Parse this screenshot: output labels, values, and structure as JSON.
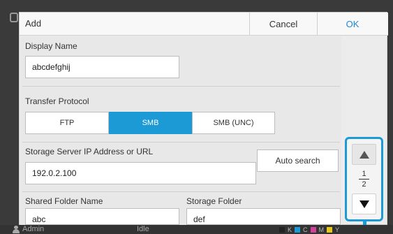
{
  "dialog": {
    "title": "Add",
    "cancel_label": "Cancel",
    "ok_label": "OK"
  },
  "fields": {
    "display_name": {
      "label": "Display Name",
      "value": "abcdefghij"
    },
    "transfer_protocol": {
      "label": "Transfer Protocol",
      "options": [
        "FTP",
        "SMB",
        "SMB (UNC)"
      ],
      "selected": "SMB"
    },
    "server": {
      "label": "Storage Server IP Address or URL",
      "value": "192.0.2.100",
      "auto_search_label": "Auto search"
    },
    "shared_folder": {
      "label": "Shared Folder Name",
      "value": "abc"
    },
    "storage_folder": {
      "label": "Storage Folder",
      "value": "def"
    }
  },
  "pager": {
    "current": "1",
    "total": "2"
  },
  "status_bar": {
    "user": "Admin",
    "state": "Idle",
    "ink_labels": [
      "K",
      "C",
      "M",
      "Y"
    ],
    "ink_colors": {
      "K": "#222222",
      "C": "#1b9ad6",
      "M": "#d6409a",
      "Y": "#e6c81a"
    }
  },
  "colors": {
    "accent": "#1b9ad6"
  }
}
